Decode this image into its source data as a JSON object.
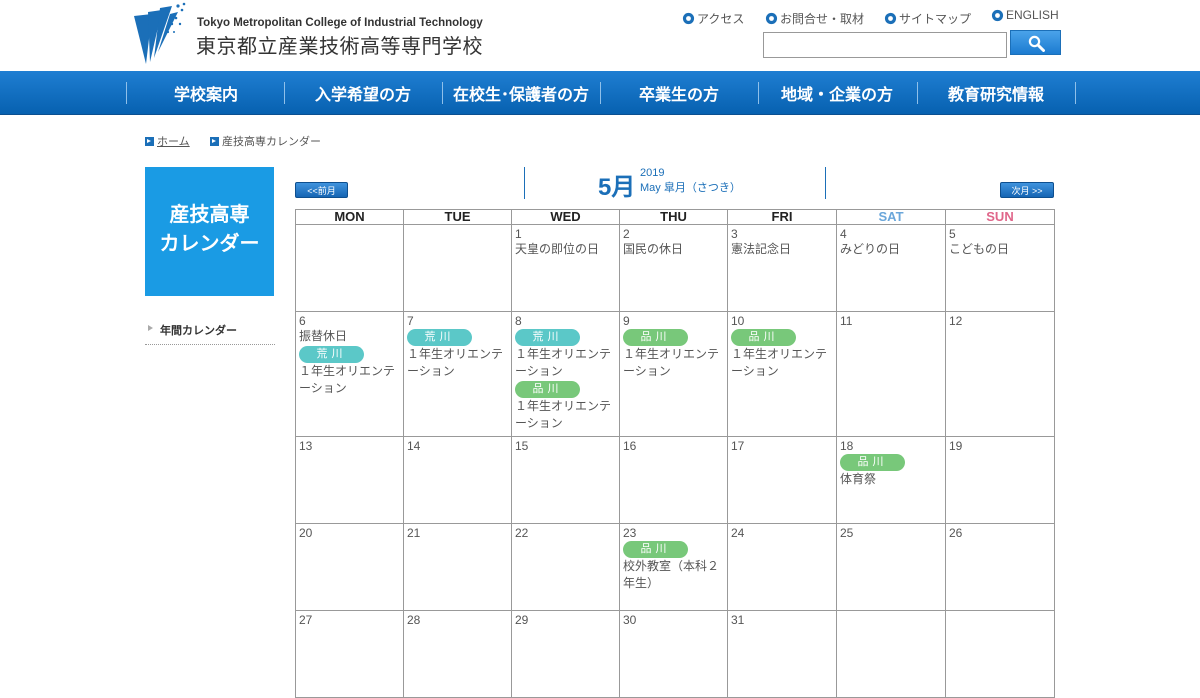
{
  "header": {
    "logo_en": "Tokyo Metropolitan College of Industrial Technology",
    "logo_ja": "東京都立産業技術高等専門学校",
    "util_links": [
      {
        "label": "アクセス",
        "icon": "gear-icon"
      },
      {
        "label": "お問合せ・取材",
        "icon": "gear-icon"
      },
      {
        "label": "サイトマップ",
        "icon": "gear-icon"
      },
      {
        "label": "ENGLISH",
        "icon": "gear-icon"
      }
    ],
    "search": {
      "value": "",
      "placeholder": ""
    }
  },
  "gnav": [
    "学校案内",
    "入学希望の方",
    "在校生･保護者の方",
    "卒業生の方",
    "地域・企業の方",
    "教育研究情報"
  ],
  "breadcrumb": {
    "home": "ホーム",
    "current": "産技高専カレンダー"
  },
  "sidebar": {
    "title_line1": "産技高専",
    "title_line2": "カレンダー",
    "link": "年間カレンダー"
  },
  "month": {
    "prev": "<<前月",
    "next": "次月 >>",
    "number": "5月",
    "year": "2019",
    "en": "May 皐月（さつき）"
  },
  "calendar": {
    "weekdays": [
      "MON",
      "TUE",
      "WED",
      "THU",
      "FRI",
      "SAT",
      "SUN"
    ],
    "weekday_colors": [
      "#222222",
      "#222222",
      "#222222",
      "#222222",
      "#222222",
      "#6aa6da",
      "#e0668a"
    ],
    "campus_colors": {
      "荒川": "#5bc8c8",
      "品川": "#78c87a"
    },
    "weeks": [
      [
        {
          "day": "",
          "items": []
        },
        {
          "day": "",
          "items": []
        },
        {
          "day": "1",
          "items": [
            {
              "text": "天皇の即位の日"
            }
          ]
        },
        {
          "day": "2",
          "items": [
            {
              "text": "国民の休日"
            }
          ]
        },
        {
          "day": "3",
          "items": [
            {
              "text": "憲法記念日"
            }
          ]
        },
        {
          "day": "4",
          "items": [
            {
              "text": "みどりの日"
            }
          ]
        },
        {
          "day": "5",
          "items": [
            {
              "text": "こどもの日"
            }
          ]
        }
      ],
      [
        {
          "day": "6",
          "items": [
            {
              "text": "振替休日"
            },
            {
              "badge": "荒川"
            },
            {
              "text": "１年生オリエンテーション"
            }
          ]
        },
        {
          "day": "7",
          "items": [
            {
              "badge": "荒川"
            },
            {
              "text": "１年生オリエンテーション"
            }
          ]
        },
        {
          "day": "8",
          "items": [
            {
              "badge": "荒川"
            },
            {
              "text": "１年生オリエンテーション"
            },
            {
              "badge": "品川"
            },
            {
              "text": "１年生オリエンテーション"
            }
          ]
        },
        {
          "day": "9",
          "items": [
            {
              "badge": "品川"
            },
            {
              "text": "１年生オリエンテーション"
            }
          ]
        },
        {
          "day": "10",
          "items": [
            {
              "badge": "品川"
            },
            {
              "text": "１年生オリエンテーション"
            }
          ]
        },
        {
          "day": "11",
          "items": []
        },
        {
          "day": "12",
          "items": []
        }
      ],
      [
        {
          "day": "13",
          "items": []
        },
        {
          "day": "14",
          "items": []
        },
        {
          "day": "15",
          "items": []
        },
        {
          "day": "16",
          "items": []
        },
        {
          "day": "17",
          "items": []
        },
        {
          "day": "18",
          "items": [
            {
              "badge": "品川"
            },
            {
              "text": "体育祭"
            }
          ]
        },
        {
          "day": "19",
          "items": []
        }
      ],
      [
        {
          "day": "20",
          "items": []
        },
        {
          "day": "21",
          "items": []
        },
        {
          "day": "22",
          "items": []
        },
        {
          "day": "23",
          "items": [
            {
              "badge": "品川"
            },
            {
              "text": "校外教室（本科２年生）"
            }
          ]
        },
        {
          "day": "24",
          "items": []
        },
        {
          "day": "25",
          "items": []
        },
        {
          "day": "26",
          "items": []
        }
      ],
      [
        {
          "day": "27",
          "items": []
        },
        {
          "day": "28",
          "items": []
        },
        {
          "day": "29",
          "items": []
        },
        {
          "day": "30",
          "items": []
        },
        {
          "day": "31",
          "items": []
        },
        {
          "day": "",
          "items": []
        },
        {
          "day": "",
          "items": []
        }
      ]
    ]
  }
}
